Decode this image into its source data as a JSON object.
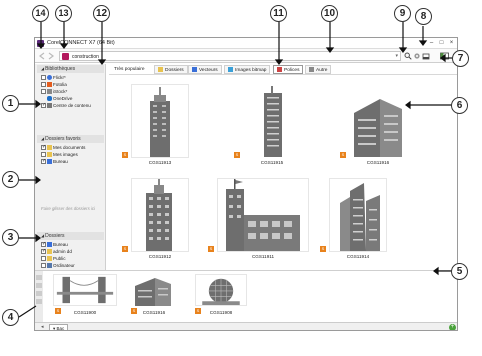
{
  "window": {
    "title": "CorelCONNECT X7 (64 Bit)",
    "minimize_glyph": "–",
    "maximize_glyph": "□",
    "close_glyph": "×"
  },
  "toolbar": {
    "back_icon": "arrow-left-icon",
    "forward_icon": "arrow-right-icon",
    "path_value": "construction",
    "search_icon": "search-icon",
    "options_icon": "gear-icon",
    "tray_icon": "tray-icon",
    "panel_icon": "panel-icon"
  },
  "sidebar": {
    "libraries_header": "Bibliothèques",
    "libraries": [
      {
        "label": "Flickr*",
        "checked": false
      },
      {
        "label": "Fotolia",
        "checked": false
      },
      {
        "label": "iStock*",
        "checked": false
      },
      {
        "label": "OneDrive",
        "checked": false
      },
      {
        "label": "Centre de contenu",
        "checked": true
      }
    ],
    "favorites_header": "Dossiers favoris",
    "favorites": [
      {
        "label": "Mes documents",
        "checked": true
      },
      {
        "label": "Mes images",
        "checked": false
      },
      {
        "label": "Bureau",
        "checked": true
      }
    ],
    "drop_hint": "Faire glisser des dossiers ici",
    "folders_header": "Dossiers",
    "folders": [
      {
        "label": "Bureau",
        "checked": true
      },
      {
        "label": "admin dd",
        "checked": true
      },
      {
        "label": "Public",
        "checked": false
      },
      {
        "label": "Ordinateur",
        "checked": false
      },
      {
        "label": "Réseau",
        "checked": false
      }
    ]
  },
  "filter_tabs": [
    {
      "label": "Très populaire"
    },
    {
      "label": "Dossiers"
    },
    {
      "label": "Vecteurs"
    },
    {
      "label": "Images bitmap"
    },
    {
      "label": "Polices"
    },
    {
      "label": "Autre"
    }
  ],
  "results": [
    {
      "caption": "CGS11913",
      "badge": "S"
    },
    {
      "caption": "CGS11915",
      "badge": "S"
    },
    {
      "caption": "CGS11916",
      "badge": "S"
    },
    {
      "caption": "CGS11912",
      "badge": "S"
    },
    {
      "caption": "CGS11911",
      "badge": "S"
    },
    {
      "caption": "CGS11914",
      "badge": "S"
    }
  ],
  "tray": {
    "items": [
      {
        "caption": "CGS11900",
        "badge": "S"
      },
      {
        "caption": "CGS11916",
        "badge": "S"
      },
      {
        "caption": "CGS11908",
        "badge": "S"
      }
    ],
    "tab_label": "Bac",
    "add_glyph": "+"
  },
  "callouts": [
    "1",
    "2",
    "3",
    "4",
    "5",
    "6",
    "7",
    "8",
    "9",
    "10",
    "11",
    "12",
    "13",
    "14"
  ],
  "colors": {
    "accent": "#e8821c",
    "building": "#6e6e6e"
  }
}
